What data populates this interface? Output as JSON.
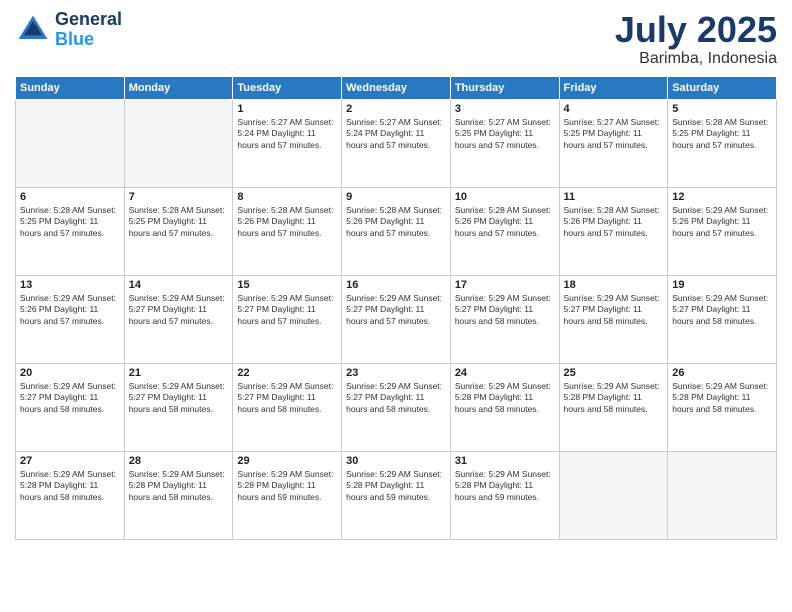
{
  "logo": {
    "line1": "General",
    "line2": "Blue"
  },
  "title": "July 2025",
  "location": "Barimba, Indonesia",
  "weekdays": [
    "Sunday",
    "Monday",
    "Tuesday",
    "Wednesday",
    "Thursday",
    "Friday",
    "Saturday"
  ],
  "weeks": [
    [
      {
        "day": "",
        "info": ""
      },
      {
        "day": "",
        "info": ""
      },
      {
        "day": "1",
        "info": "Sunrise: 5:27 AM\nSunset: 5:24 PM\nDaylight: 11 hours and 57 minutes."
      },
      {
        "day": "2",
        "info": "Sunrise: 5:27 AM\nSunset: 5:24 PM\nDaylight: 11 hours and 57 minutes."
      },
      {
        "day": "3",
        "info": "Sunrise: 5:27 AM\nSunset: 5:25 PM\nDaylight: 11 hours and 57 minutes."
      },
      {
        "day": "4",
        "info": "Sunrise: 5:27 AM\nSunset: 5:25 PM\nDaylight: 11 hours and 57 minutes."
      },
      {
        "day": "5",
        "info": "Sunrise: 5:28 AM\nSunset: 5:25 PM\nDaylight: 11 hours and 57 minutes."
      }
    ],
    [
      {
        "day": "6",
        "info": "Sunrise: 5:28 AM\nSunset: 5:25 PM\nDaylight: 11 hours and 57 minutes."
      },
      {
        "day": "7",
        "info": "Sunrise: 5:28 AM\nSunset: 5:25 PM\nDaylight: 11 hours and 57 minutes."
      },
      {
        "day": "8",
        "info": "Sunrise: 5:28 AM\nSunset: 5:26 PM\nDaylight: 11 hours and 57 minutes."
      },
      {
        "day": "9",
        "info": "Sunrise: 5:28 AM\nSunset: 5:26 PM\nDaylight: 11 hours and 57 minutes."
      },
      {
        "day": "10",
        "info": "Sunrise: 5:28 AM\nSunset: 5:26 PM\nDaylight: 11 hours and 57 minutes."
      },
      {
        "day": "11",
        "info": "Sunrise: 5:28 AM\nSunset: 5:26 PM\nDaylight: 11 hours and 57 minutes."
      },
      {
        "day": "12",
        "info": "Sunrise: 5:29 AM\nSunset: 5:26 PM\nDaylight: 11 hours and 57 minutes."
      }
    ],
    [
      {
        "day": "13",
        "info": "Sunrise: 5:29 AM\nSunset: 5:26 PM\nDaylight: 11 hours and 57 minutes."
      },
      {
        "day": "14",
        "info": "Sunrise: 5:29 AM\nSunset: 5:27 PM\nDaylight: 11 hours and 57 minutes."
      },
      {
        "day": "15",
        "info": "Sunrise: 5:29 AM\nSunset: 5:27 PM\nDaylight: 11 hours and 57 minutes."
      },
      {
        "day": "16",
        "info": "Sunrise: 5:29 AM\nSunset: 5:27 PM\nDaylight: 11 hours and 57 minutes."
      },
      {
        "day": "17",
        "info": "Sunrise: 5:29 AM\nSunset: 5:27 PM\nDaylight: 11 hours and 58 minutes."
      },
      {
        "day": "18",
        "info": "Sunrise: 5:29 AM\nSunset: 5:27 PM\nDaylight: 11 hours and 58 minutes."
      },
      {
        "day": "19",
        "info": "Sunrise: 5:29 AM\nSunset: 5:27 PM\nDaylight: 11 hours and 58 minutes."
      }
    ],
    [
      {
        "day": "20",
        "info": "Sunrise: 5:29 AM\nSunset: 5:27 PM\nDaylight: 11 hours and 58 minutes."
      },
      {
        "day": "21",
        "info": "Sunrise: 5:29 AM\nSunset: 5:27 PM\nDaylight: 11 hours and 58 minutes."
      },
      {
        "day": "22",
        "info": "Sunrise: 5:29 AM\nSunset: 5:27 PM\nDaylight: 11 hours and 58 minutes."
      },
      {
        "day": "23",
        "info": "Sunrise: 5:29 AM\nSunset: 5:27 PM\nDaylight: 11 hours and 58 minutes."
      },
      {
        "day": "24",
        "info": "Sunrise: 5:29 AM\nSunset: 5:28 PM\nDaylight: 11 hours and 58 minutes."
      },
      {
        "day": "25",
        "info": "Sunrise: 5:29 AM\nSunset: 5:28 PM\nDaylight: 11 hours and 58 minutes."
      },
      {
        "day": "26",
        "info": "Sunrise: 5:29 AM\nSunset: 5:28 PM\nDaylight: 11 hours and 58 minutes."
      }
    ],
    [
      {
        "day": "27",
        "info": "Sunrise: 5:29 AM\nSunset: 5:28 PM\nDaylight: 11 hours and 58 minutes."
      },
      {
        "day": "28",
        "info": "Sunrise: 5:29 AM\nSunset: 5:28 PM\nDaylight: 11 hours and 58 minutes."
      },
      {
        "day": "29",
        "info": "Sunrise: 5:29 AM\nSunset: 5:28 PM\nDaylight: 11 hours and 59 minutes."
      },
      {
        "day": "30",
        "info": "Sunrise: 5:29 AM\nSunset: 5:28 PM\nDaylight: 11 hours and 59 minutes."
      },
      {
        "day": "31",
        "info": "Sunrise: 5:29 AM\nSunset: 5:28 PM\nDaylight: 11 hours and 59 minutes."
      },
      {
        "day": "",
        "info": ""
      },
      {
        "day": "",
        "info": ""
      }
    ]
  ]
}
